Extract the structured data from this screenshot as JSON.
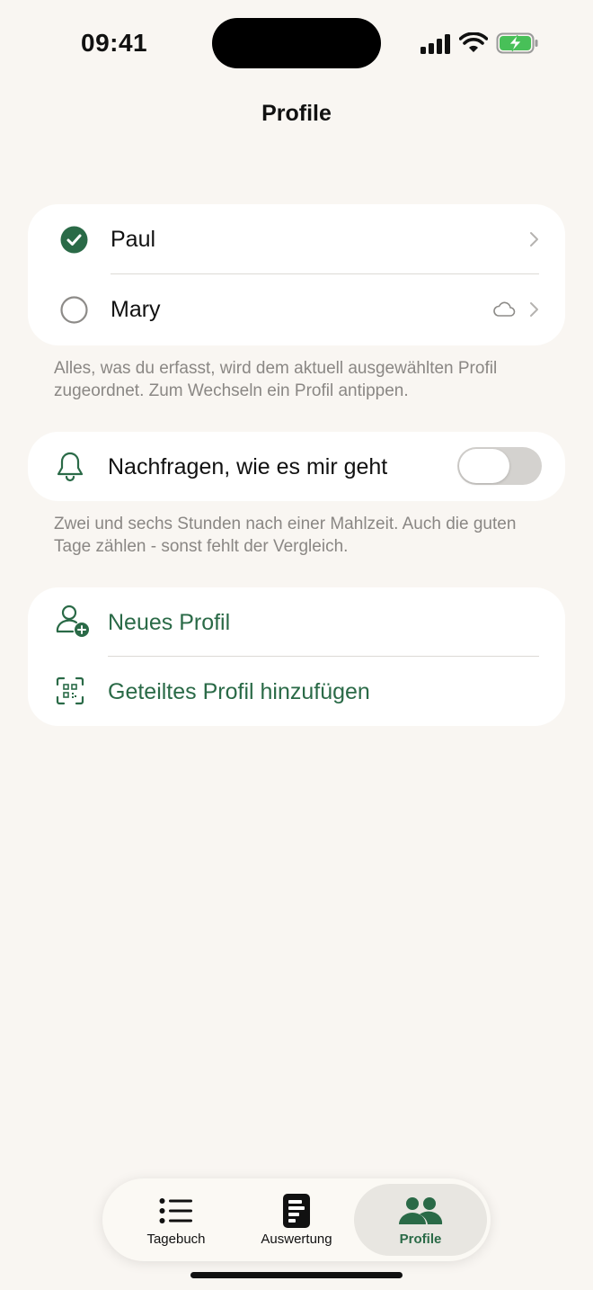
{
  "status_bar": {
    "time": "09:41"
  },
  "header": {
    "title": "Profile"
  },
  "profiles": [
    {
      "name": "Paul",
      "selected": true,
      "cloud": false
    },
    {
      "name": "Mary",
      "selected": false,
      "cloud": true
    }
  ],
  "profiles_footnote": "Alles, was du erfasst, wird dem aktuell ausgewählten Profil zugeordnet. Zum Wechseln ein Profil antippen.",
  "notification": {
    "label": "Nachfragen, wie es mir geht",
    "enabled": false
  },
  "notification_footnote": "Zwei und sechs Stunden nach einer Mahlzeit. Auch die guten Tage zählen - sonst fehlt der Vergleich.",
  "actions": {
    "new_profile": "Neues Profil",
    "add_shared_profile": "Geteiltes Profil hinzufügen"
  },
  "tabs": [
    {
      "label": "Tagebuch",
      "icon": "list-icon",
      "active": false
    },
    {
      "label": "Auswertung",
      "icon": "report-icon",
      "active": false
    },
    {
      "label": "Profile",
      "icon": "people-icon",
      "active": true
    }
  ],
  "colors": {
    "accent": "#2a6a47",
    "background": "#f9f6f2",
    "card": "#ffffff"
  }
}
